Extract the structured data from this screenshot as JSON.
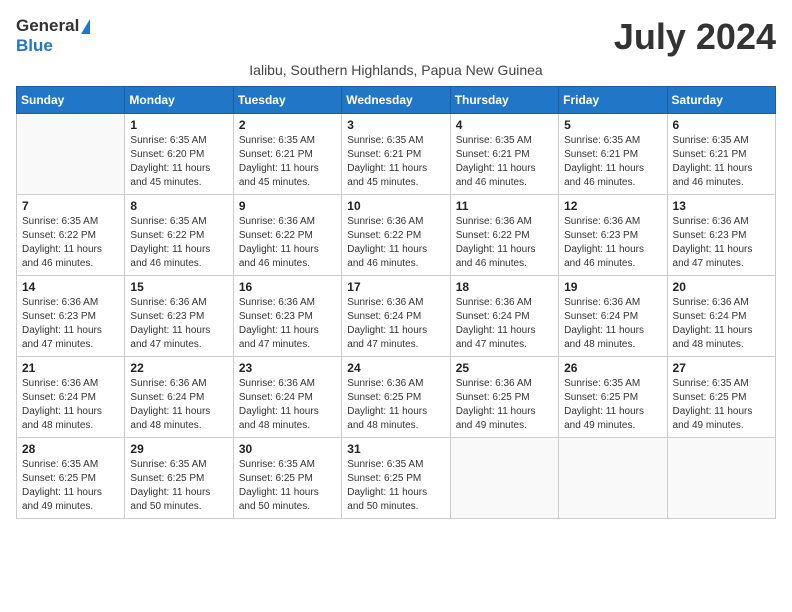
{
  "logo": {
    "general": "General",
    "blue": "Blue"
  },
  "title": "July 2024",
  "subtitle": "Ialibu, Southern Highlands, Papua New Guinea",
  "days_of_week": [
    "Sunday",
    "Monday",
    "Tuesday",
    "Wednesday",
    "Thursday",
    "Friday",
    "Saturday"
  ],
  "weeks": [
    [
      {
        "day": "",
        "detail": ""
      },
      {
        "day": "1",
        "detail": "Sunrise: 6:35 AM\nSunset: 6:20 PM\nDaylight: 11 hours\nand 45 minutes."
      },
      {
        "day": "2",
        "detail": "Sunrise: 6:35 AM\nSunset: 6:21 PM\nDaylight: 11 hours\nand 45 minutes."
      },
      {
        "day": "3",
        "detail": "Sunrise: 6:35 AM\nSunset: 6:21 PM\nDaylight: 11 hours\nand 45 minutes."
      },
      {
        "day": "4",
        "detail": "Sunrise: 6:35 AM\nSunset: 6:21 PM\nDaylight: 11 hours\nand 46 minutes."
      },
      {
        "day": "5",
        "detail": "Sunrise: 6:35 AM\nSunset: 6:21 PM\nDaylight: 11 hours\nand 46 minutes."
      },
      {
        "day": "6",
        "detail": "Sunrise: 6:35 AM\nSunset: 6:21 PM\nDaylight: 11 hours\nand 46 minutes."
      }
    ],
    [
      {
        "day": "7",
        "detail": "Sunrise: 6:35 AM\nSunset: 6:22 PM\nDaylight: 11 hours\nand 46 minutes."
      },
      {
        "day": "8",
        "detail": "Sunrise: 6:35 AM\nSunset: 6:22 PM\nDaylight: 11 hours\nand 46 minutes."
      },
      {
        "day": "9",
        "detail": "Sunrise: 6:36 AM\nSunset: 6:22 PM\nDaylight: 11 hours\nand 46 minutes."
      },
      {
        "day": "10",
        "detail": "Sunrise: 6:36 AM\nSunset: 6:22 PM\nDaylight: 11 hours\nand 46 minutes."
      },
      {
        "day": "11",
        "detail": "Sunrise: 6:36 AM\nSunset: 6:22 PM\nDaylight: 11 hours\nand 46 minutes."
      },
      {
        "day": "12",
        "detail": "Sunrise: 6:36 AM\nSunset: 6:23 PM\nDaylight: 11 hours\nand 46 minutes."
      },
      {
        "day": "13",
        "detail": "Sunrise: 6:36 AM\nSunset: 6:23 PM\nDaylight: 11 hours\nand 47 minutes."
      }
    ],
    [
      {
        "day": "14",
        "detail": "Sunrise: 6:36 AM\nSunset: 6:23 PM\nDaylight: 11 hours\nand 47 minutes."
      },
      {
        "day": "15",
        "detail": "Sunrise: 6:36 AM\nSunset: 6:23 PM\nDaylight: 11 hours\nand 47 minutes."
      },
      {
        "day": "16",
        "detail": "Sunrise: 6:36 AM\nSunset: 6:23 PM\nDaylight: 11 hours\nand 47 minutes."
      },
      {
        "day": "17",
        "detail": "Sunrise: 6:36 AM\nSunset: 6:24 PM\nDaylight: 11 hours\nand 47 minutes."
      },
      {
        "day": "18",
        "detail": "Sunrise: 6:36 AM\nSunset: 6:24 PM\nDaylight: 11 hours\nand 47 minutes."
      },
      {
        "day": "19",
        "detail": "Sunrise: 6:36 AM\nSunset: 6:24 PM\nDaylight: 11 hours\nand 48 minutes."
      },
      {
        "day": "20",
        "detail": "Sunrise: 6:36 AM\nSunset: 6:24 PM\nDaylight: 11 hours\nand 48 minutes."
      }
    ],
    [
      {
        "day": "21",
        "detail": "Sunrise: 6:36 AM\nSunset: 6:24 PM\nDaylight: 11 hours\nand 48 minutes."
      },
      {
        "day": "22",
        "detail": "Sunrise: 6:36 AM\nSunset: 6:24 PM\nDaylight: 11 hours\nand 48 minutes."
      },
      {
        "day": "23",
        "detail": "Sunrise: 6:36 AM\nSunset: 6:24 PM\nDaylight: 11 hours\nand 48 minutes."
      },
      {
        "day": "24",
        "detail": "Sunrise: 6:36 AM\nSunset: 6:25 PM\nDaylight: 11 hours\nand 48 minutes."
      },
      {
        "day": "25",
        "detail": "Sunrise: 6:36 AM\nSunset: 6:25 PM\nDaylight: 11 hours\nand 49 minutes."
      },
      {
        "day": "26",
        "detail": "Sunrise: 6:35 AM\nSunset: 6:25 PM\nDaylight: 11 hours\nand 49 minutes."
      },
      {
        "day": "27",
        "detail": "Sunrise: 6:35 AM\nSunset: 6:25 PM\nDaylight: 11 hours\nand 49 minutes."
      }
    ],
    [
      {
        "day": "28",
        "detail": "Sunrise: 6:35 AM\nSunset: 6:25 PM\nDaylight: 11 hours\nand 49 minutes."
      },
      {
        "day": "29",
        "detail": "Sunrise: 6:35 AM\nSunset: 6:25 PM\nDaylight: 11 hours\nand 50 minutes."
      },
      {
        "day": "30",
        "detail": "Sunrise: 6:35 AM\nSunset: 6:25 PM\nDaylight: 11 hours\nand 50 minutes."
      },
      {
        "day": "31",
        "detail": "Sunrise: 6:35 AM\nSunset: 6:25 PM\nDaylight: 11 hours\nand 50 minutes."
      },
      {
        "day": "",
        "detail": ""
      },
      {
        "day": "",
        "detail": ""
      },
      {
        "day": "",
        "detail": ""
      }
    ]
  ]
}
